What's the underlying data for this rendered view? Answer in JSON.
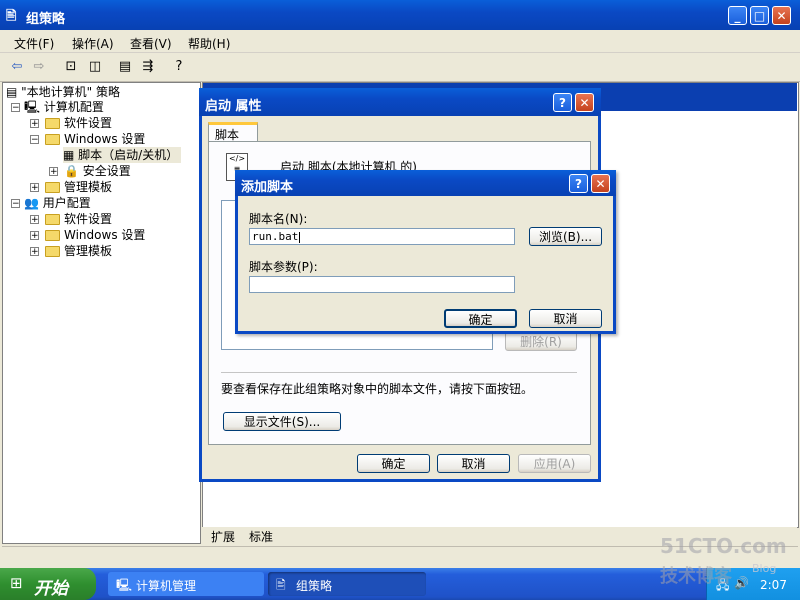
{
  "main_window": {
    "title": "组策略",
    "menu": [
      "文件(F)",
      "操作(A)",
      "查看(V)",
      "帮助(H)"
    ]
  },
  "tree": {
    "root": "\"本地计算机\" 策略",
    "computer_config": "计算机配置",
    "software_settings": "软件设置",
    "windows_settings": "Windows 设置",
    "scripts": "脚本（启动/关机）",
    "security_settings": "安全设置",
    "admin_templates": "管理模板",
    "user_config": "用户配置",
    "user_software_settings": "软件设置",
    "user_windows_settings": "Windows 设置",
    "user_admin_templates": "管理模板"
  },
  "bottom_tabs": [
    "扩展",
    "标准"
  ],
  "props_dialog": {
    "title": "启动 属性",
    "tab": "脚本",
    "heading": "启动 脚本(本地计算机 的)",
    "remove_label": "删除(R)",
    "note": "要查看保存在此组策略对象中的脚本文件，请按下面按钮。",
    "show_files_label": "显示文件(S)...",
    "ok_label": "确定",
    "cancel_label": "取消",
    "apply_label": "应用(A)"
  },
  "add_script_dialog": {
    "title": "添加脚本",
    "script_name_label": "脚本名(N):",
    "script_name_value": "run.bat",
    "browse_label": "浏览(B)...",
    "script_params_label": "脚本参数(P):",
    "script_params_value": "",
    "ok_label": "确定",
    "cancel_label": "取消"
  },
  "taskbar": {
    "start_label": "开始",
    "tasks": [
      "计算机管理",
      "组策略"
    ],
    "clock": "2:07"
  },
  "watermark": {
    "line1": "51CTO.com",
    "line2": "技术博客",
    "line3": "Blog"
  }
}
